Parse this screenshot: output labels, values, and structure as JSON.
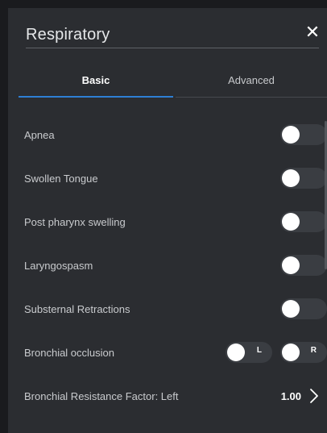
{
  "panel": {
    "title": "Respiratory",
    "close_glyph": "✕",
    "close_icon": "close-icon"
  },
  "tabs": [
    {
      "label": "Basic",
      "active": true
    },
    {
      "label": "Advanced",
      "active": false
    }
  ],
  "rows": [
    {
      "label": "Apnea",
      "control": "toggle",
      "on": false
    },
    {
      "label": "Swollen Tongue",
      "control": "toggle",
      "on": false
    },
    {
      "label": "Post pharynx swelling",
      "control": "toggle",
      "on": false
    },
    {
      "label": "Laryngospasm",
      "control": "toggle",
      "on": false
    },
    {
      "label": "Substernal Retractions",
      "control": "toggle",
      "on": false
    },
    {
      "label": "Bronchial occlusion",
      "control": "dual-toggle",
      "left_toggle": {
        "label": "L",
        "on": false
      },
      "right_toggle": {
        "label": "R",
        "on": false
      }
    },
    {
      "label": "Bronchial Resistance Factor: Left",
      "control": "value",
      "value": "1.00",
      "icon": "chevron-right-icon"
    }
  ],
  "colors": {
    "accent": "#2e7fd4",
    "panel_bg": "#2b2d31",
    "toggle_track_off": "#3a3d42"
  }
}
